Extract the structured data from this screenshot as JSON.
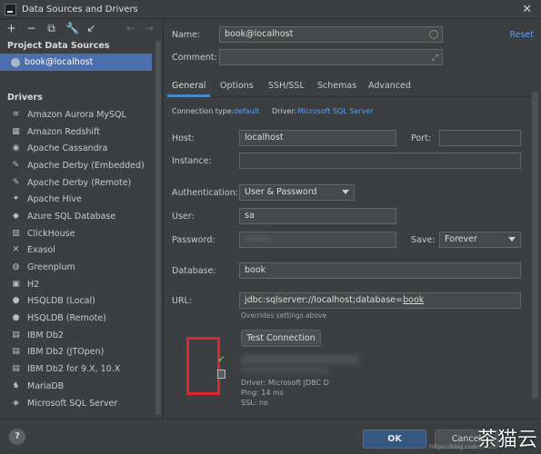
{
  "window": {
    "title": "Data Sources and Drivers"
  },
  "left": {
    "project_section": "Project Data Sources",
    "project_item": "book@localhost",
    "drivers_section": "Drivers",
    "drivers": [
      {
        "label": "Amazon Aurora MySQL",
        "icon": "aurora-icon"
      },
      {
        "label": "Amazon Redshift",
        "icon": "redshift-icon"
      },
      {
        "label": "Apache Cassandra",
        "icon": "cassandra-icon"
      },
      {
        "label": "Apache Derby (Embedded)",
        "icon": "derby-icon"
      },
      {
        "label": "Apache Derby (Remote)",
        "icon": "derby-icon"
      },
      {
        "label": "Apache Hive",
        "icon": "hive-icon"
      },
      {
        "label": "Azure SQL Database",
        "icon": "azure-icon"
      },
      {
        "label": "ClickHouse",
        "icon": "clickhouse-icon"
      },
      {
        "label": "Exasol",
        "icon": "exasol-icon"
      },
      {
        "label": "Greenplum",
        "icon": "greenplum-icon"
      },
      {
        "label": "H2",
        "icon": "h2-icon"
      },
      {
        "label": "HSQLDB (Local)",
        "icon": "hsqldb-icon"
      },
      {
        "label": "HSQLDB (Remote)",
        "icon": "hsqldb-icon"
      },
      {
        "label": "IBM Db2",
        "icon": "ibm-icon"
      },
      {
        "label": "IBM Db2 (JTOpen)",
        "icon": "ibm-icon"
      },
      {
        "label": "IBM Db2 for 9.X, 10.X",
        "icon": "ibm-icon"
      },
      {
        "label": "MariaDB",
        "icon": "mariadb-icon"
      },
      {
        "label": "Microsoft SQL Server",
        "icon": "sqlserver-icon"
      }
    ]
  },
  "form": {
    "name_label": "Name:",
    "name_value": "book@localhost",
    "comment_label": "Comment:",
    "comment_value": "",
    "reset": "Reset",
    "tabs": [
      "General",
      "Options",
      "SSH/SSL",
      "Schemas",
      "Advanced"
    ],
    "conn_type_label": "Connection type:",
    "conn_type_value": "default",
    "driver_label": "Driver:",
    "driver_value": "Microsoft SQL Server",
    "host_label": "Host:",
    "host_value": "localhost",
    "port_label": "Port:",
    "port_value": "",
    "instance_label": "Instance:",
    "instance_value": "",
    "auth_label": "Authentication:",
    "auth_value": "User & Password",
    "user_label": "User:",
    "user_value": "sa",
    "password_label": "Password:",
    "password_value": "hidden",
    "save_label": "Save:",
    "save_value": "Forever",
    "database_label": "Database:",
    "database_value": "book",
    "url_label": "URL:",
    "url_prefix": "jdbc:sqlserver://localhost;database=",
    "url_db": "book",
    "url_note": "Overrides settings above",
    "test_button": "Test Connection",
    "result_driver": "Driver: Microsoft JDBC D",
    "result_ping": "Ping: 14 ms",
    "result_ssl": "SSL: no"
  },
  "footer": {
    "help": "?",
    "ok": "OK",
    "cancel": "Cancel",
    "watermark_url": "https://blog.csdn",
    "watermark_text": "茶猫云"
  }
}
